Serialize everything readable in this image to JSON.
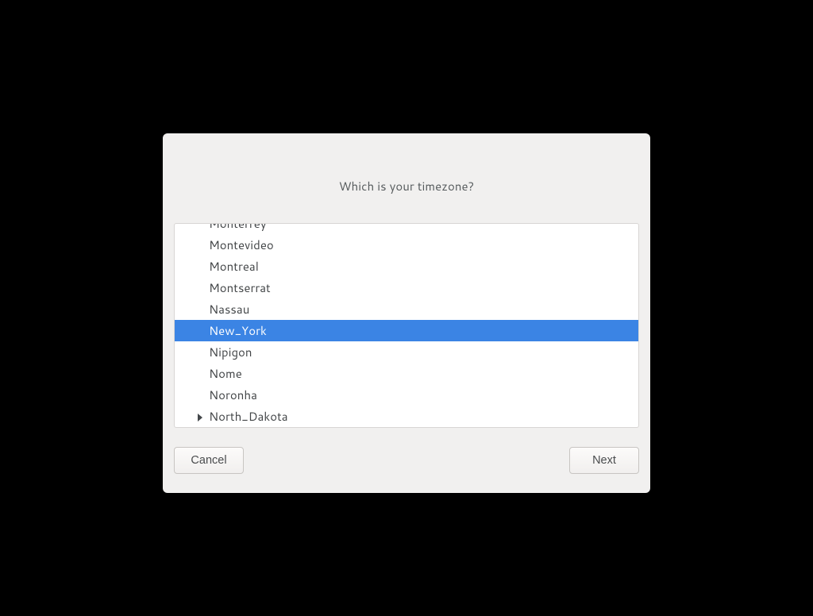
{
  "dialog": {
    "title": "Which is your timezone?"
  },
  "timezones": {
    "visible": [
      {
        "label": "Monterrey",
        "clipped": true,
        "expandable": false,
        "selected": false
      },
      {
        "label": "Montevideo",
        "clipped": false,
        "expandable": false,
        "selected": false
      },
      {
        "label": "Montreal",
        "clipped": false,
        "expandable": false,
        "selected": false
      },
      {
        "label": "Montserrat",
        "clipped": false,
        "expandable": false,
        "selected": false
      },
      {
        "label": "Nassau",
        "clipped": false,
        "expandable": false,
        "selected": false
      },
      {
        "label": "New_York",
        "clipped": false,
        "expandable": false,
        "selected": true
      },
      {
        "label": "Nipigon",
        "clipped": false,
        "expandable": false,
        "selected": false
      },
      {
        "label": "Nome",
        "clipped": false,
        "expandable": false,
        "selected": false
      },
      {
        "label": "Noronha",
        "clipped": false,
        "expandable": false,
        "selected": false
      },
      {
        "label": "North_Dakota",
        "clipped": false,
        "expandable": true,
        "selected": false
      }
    ]
  },
  "buttons": {
    "cancel": "Cancel",
    "next": "Next"
  },
  "colors": {
    "selection": "#3b84e4",
    "dialogBg": "#f1f0ef",
    "listBg": "#ffffff"
  }
}
